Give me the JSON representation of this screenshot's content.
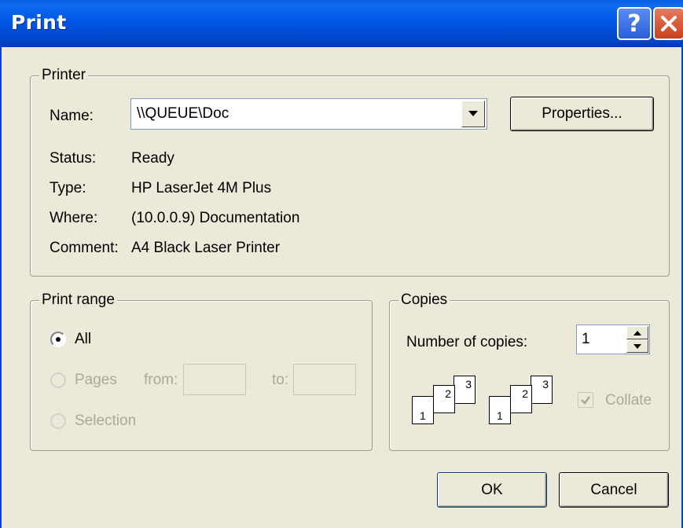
{
  "window": {
    "title": "Print",
    "help_glyph": "?",
    "close_icon": "close-icon"
  },
  "printer": {
    "legend": "Printer",
    "name_label": "Name:",
    "name_value": "\\\\QUEUE\\Doc",
    "properties_button": "Properties...",
    "status_label": "Status:",
    "status_value": "Ready",
    "type_label": "Type:",
    "type_value": "HP LaserJet 4M Plus",
    "where_label": "Where:",
    "where_value": "(10.0.0.9) Documentation",
    "comment_label": "Comment:",
    "comment_value": "A4 Black Laser Printer"
  },
  "print_range": {
    "legend": "Print range",
    "all_label": "All",
    "pages_label": "Pages",
    "from_label": "from:",
    "to_label": "to:",
    "selection_label": "Selection",
    "selected": "All"
  },
  "copies": {
    "legend": "Copies",
    "number_label": "Number of copies:",
    "number_value": "1",
    "collate_label": "Collate",
    "collate_checked": true,
    "collate_pages": [
      "1",
      "2",
      "3"
    ]
  },
  "buttons": {
    "ok": "OK",
    "cancel": "Cancel"
  }
}
